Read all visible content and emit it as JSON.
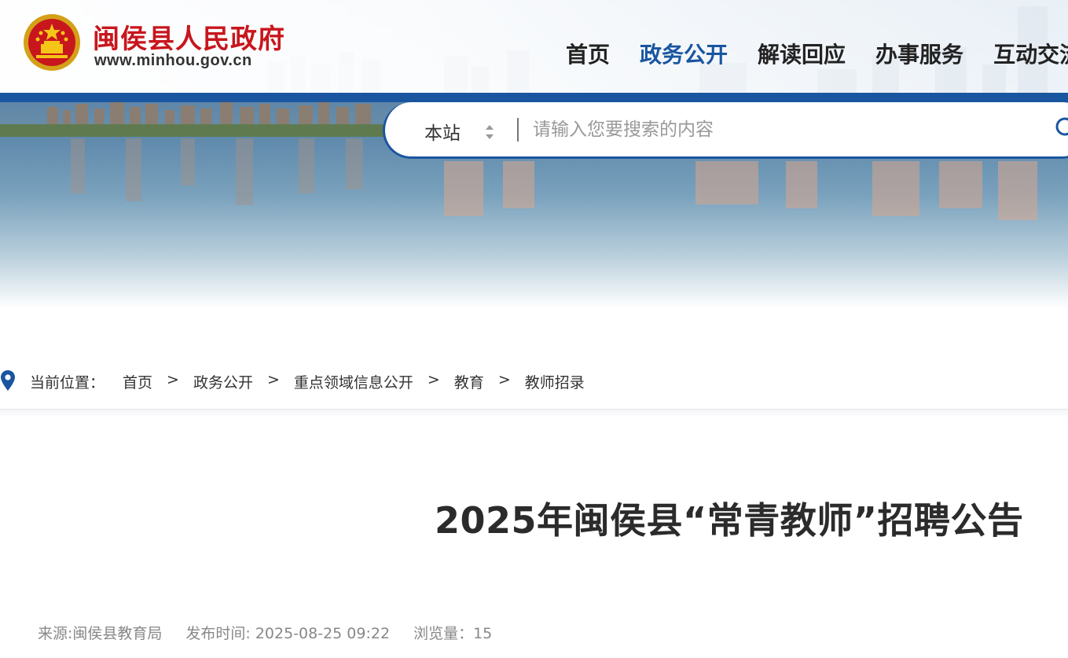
{
  "header": {
    "site_name": "闽侯县人民政府",
    "site_url": "www.minhou.gov.cn",
    "emblem_icon": "national-emblem-icon",
    "nav": [
      {
        "label": "首页",
        "active": false
      },
      {
        "label": "政务公开",
        "active": true
      },
      {
        "label": "解读回应",
        "active": false
      },
      {
        "label": "办事服务",
        "active": false
      },
      {
        "label": "互动交流",
        "active": false
      }
    ]
  },
  "search": {
    "scope": "本站",
    "placeholder": "请输入您要搜索的内容"
  },
  "breadcrumb": {
    "label": "当前位置：",
    "items": [
      "首页",
      "政务公开",
      "重点领域信息公开",
      "教育",
      "教师招录"
    ],
    "separator": ">"
  },
  "article": {
    "title": "2025年闽侯县“常青教师”招聘公告",
    "source": "来源:闽侯县教育局",
    "published": "发布时间: 2025-08-25 09:22",
    "views": "浏览量：15"
  },
  "colors": {
    "accent": "#1a56a0",
    "brand_red": "#c8161d",
    "text": "#333333",
    "muted": "#888888"
  }
}
